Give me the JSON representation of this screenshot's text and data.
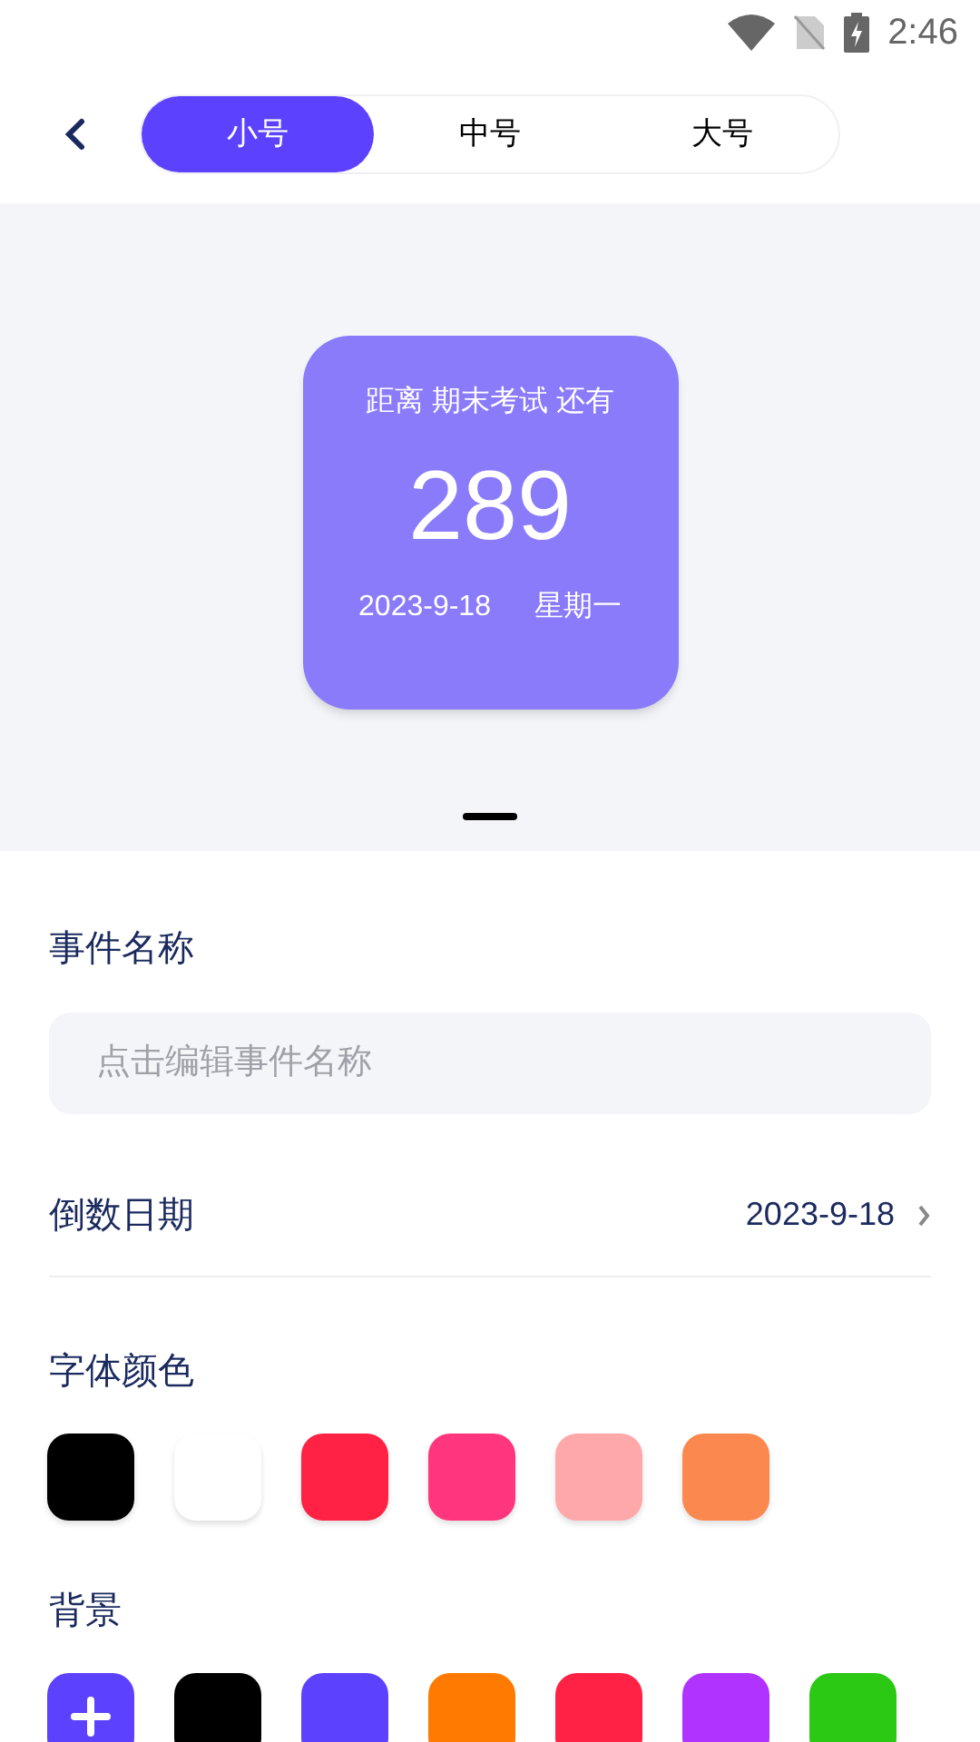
{
  "status_bar": {
    "time": "2:46"
  },
  "size_tabs": [
    {
      "label": "小号",
      "selected": true
    },
    {
      "label": "中号",
      "selected": false
    },
    {
      "label": "大号",
      "selected": false
    }
  ],
  "preview_card": {
    "title": "距离 期末考试 还有",
    "days": "289",
    "date": "2023-9-18",
    "weekday": "星期一"
  },
  "event_name": {
    "label": "事件名称",
    "placeholder": "点击编辑事件名称"
  },
  "countdown_date": {
    "label": "倒数日期",
    "value": "2023-9-18"
  },
  "font_color": {
    "label": "字体颜色",
    "swatches": [
      {
        "color": "#000000"
      },
      {
        "color": "#ffffff"
      },
      {
        "color": "#ff2244"
      },
      {
        "color": "#ff367e"
      },
      {
        "color": "#ffa8aa"
      },
      {
        "color": "#fb884e"
      }
    ]
  },
  "background": {
    "label": "背景",
    "swatches": [
      {
        "kind": "add",
        "color": "#5c42ff"
      },
      {
        "kind": "color",
        "color": "#000000"
      },
      {
        "kind": "color",
        "color": "#5c42ff"
      },
      {
        "kind": "color",
        "color": "#ff7a00"
      },
      {
        "kind": "color",
        "color": "#ff2244"
      },
      {
        "kind": "color",
        "color": "#b033ff"
      },
      {
        "kind": "color",
        "color": "#2bc814"
      }
    ]
  }
}
